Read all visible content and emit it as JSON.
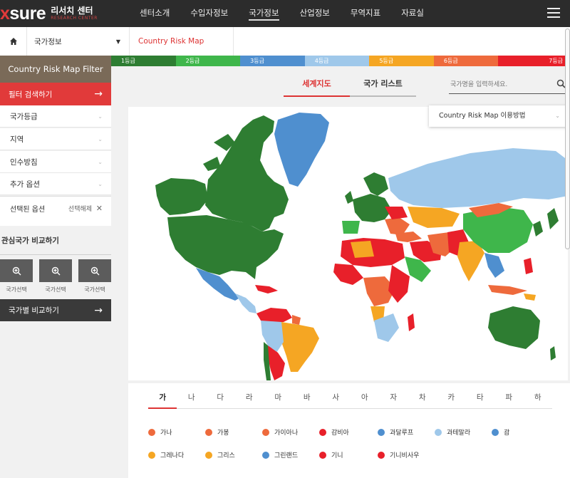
{
  "header": {
    "logo_mark": "sure",
    "logo_ko": "리서치 센터",
    "logo_en": "RESEARCH CENTER",
    "nav": [
      "센터소개",
      "수입자정보",
      "국가정보",
      "산업정보",
      "무역지표",
      "자료실"
    ],
    "active_nav": "국가정보"
  },
  "breadcrumb": {
    "level1": "국가정보",
    "level2": "Country Risk Map"
  },
  "grades": [
    {
      "label": "1등급",
      "color": "#2e7d32"
    },
    {
      "label": "2등급",
      "color": "#3fb64b"
    },
    {
      "label": "3등급",
      "color": "#4f8fcf"
    },
    {
      "label": "4등급",
      "color": "#9fc8ea"
    },
    {
      "label": "5등급",
      "color": "#f5a623"
    },
    {
      "label": "6등급",
      "color": "#ee6a3c"
    },
    {
      "label": "7등급",
      "color": "#e8202a"
    }
  ],
  "sidebar": {
    "title": "Country Risk Map Filter",
    "filter_button": "필터 검색하기",
    "filters": [
      "국가등급",
      "지역",
      "인수방침",
      "추가 옵션"
    ],
    "selected_label": "선택된 옵션",
    "clear_label": "선택해제",
    "compare_title": "관심국가 비교하기",
    "compare_slots": [
      "국가선택",
      "국가선택",
      "국가선택"
    ],
    "compare_button": "국가별 비교하기"
  },
  "tabs": {
    "world": "세계지도",
    "list": "국가 리스트"
  },
  "search": {
    "placeholder": "국가명을 입력하세요."
  },
  "howto": {
    "label": "Country Risk Map 이용방법"
  },
  "consonants": [
    "가",
    "나",
    "다",
    "라",
    "마",
    "바",
    "사",
    "아",
    "자",
    "차",
    "카",
    "타",
    "파",
    "하"
  ],
  "active_consonant": "가",
  "countries": [
    {
      "name": "가나",
      "color": "#ee6a3c"
    },
    {
      "name": "가봉",
      "color": "#ee6a3c"
    },
    {
      "name": "가이아나",
      "color": "#ee6a3c"
    },
    {
      "name": "감비아",
      "color": "#e8202a"
    },
    {
      "name": "과달루프",
      "color": "#4f8fcf"
    },
    {
      "name": "과테말라",
      "color": "#9fc8ea"
    },
    {
      "name": "괌",
      "color": "#4f8fcf"
    },
    {
      "name": "그레나다",
      "color": "#f5a623"
    },
    {
      "name": "그리스",
      "color": "#f5a623"
    },
    {
      "name": "그린랜드",
      "color": "#4f8fcf"
    },
    {
      "name": "기니",
      "color": "#e8202a"
    },
    {
      "name": "기니비사우",
      "color": "#e8202a"
    }
  ]
}
